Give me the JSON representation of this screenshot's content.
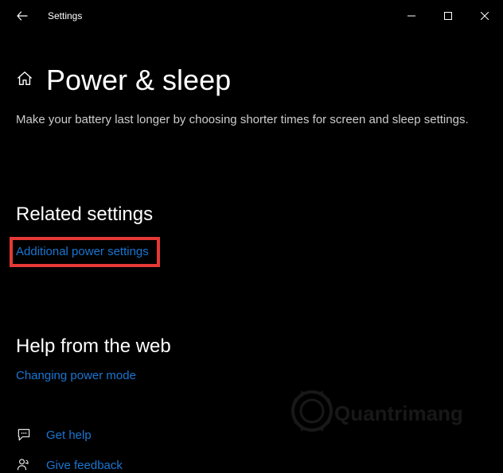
{
  "window": {
    "title": "Settings"
  },
  "page": {
    "title": "Power & sleep",
    "description": "Make your battery last longer by choosing shorter times for screen and sleep settings."
  },
  "related": {
    "heading": "Related settings",
    "link": "Additional power settings"
  },
  "web": {
    "heading": "Help from the web",
    "link": "Changing power mode"
  },
  "actions": {
    "help": "Get help",
    "feedback": "Give feedback"
  },
  "watermark": "Quantrimang"
}
